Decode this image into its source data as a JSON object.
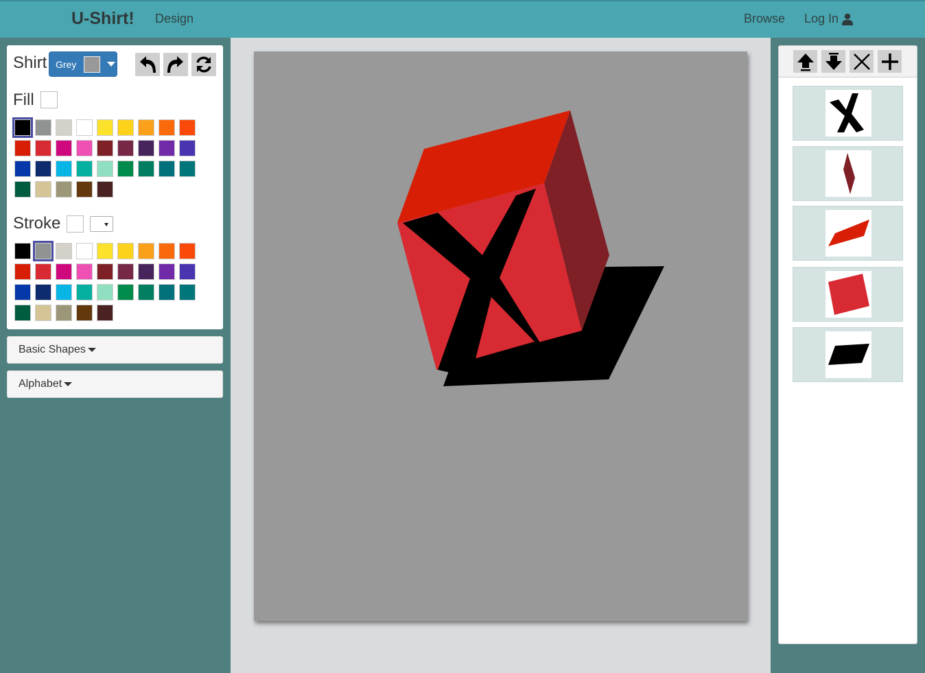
{
  "navbar": {
    "brand": "U-Shirt!",
    "design": "Design",
    "browse": "Browse",
    "login": "Log In"
  },
  "shirt": {
    "label": "Shirt",
    "selected_color_name": "Grey",
    "selected_color": "#999999"
  },
  "fill": {
    "label": "Fill",
    "current": "#ffffff",
    "selected_index": 0
  },
  "stroke": {
    "label": "Stroke",
    "current": "#ffffff",
    "selected_index": 1
  },
  "palette": [
    "#000000",
    "#8f9391",
    "#d3d1c8",
    "#ffffff",
    "#fce22b",
    "#fcd21a",
    "#faa01a",
    "#fa6a0a",
    "#fa4a0a",
    "#d81e05",
    "#d82a32",
    "#d0087d",
    "#ee50b4",
    "#7f2027",
    "#772846",
    "#47255c",
    "#712aa8",
    "#4a34b0",
    "#0538a8",
    "#0d2b6d",
    "#08b6e6",
    "#06b0a0",
    "#8fdfc0",
    "#008a4c",
    "#007e61",
    "#00707a",
    "#00767a",
    "#005c40",
    "#d5c496",
    "#9d977a",
    "#63380d",
    "#4a2222"
  ],
  "accordions": {
    "basic_shapes": "Basic Shapes",
    "alphabet": "Alphabet"
  },
  "toolbar_icons": {
    "undo": "undo-icon",
    "redo": "redo-icon",
    "refresh": "refresh-icon"
  },
  "layers_toolbar": [
    "move-up-icon",
    "move-down-icon",
    "delete-icon",
    "add-icon"
  ],
  "layers": [
    {
      "name": "letter-x",
      "color": "#000000"
    },
    {
      "name": "rhombus-narrow",
      "color": "#7f2027"
    },
    {
      "name": "parallelogram-red",
      "color": "#d81e05"
    },
    {
      "name": "square-red",
      "color": "#d82a32"
    },
    {
      "name": "parallelogram-black",
      "color": "#000000"
    }
  ],
  "colors": {
    "navbar": "#4aa6b0",
    "background": "#507f80",
    "accent": "#337ab7"
  }
}
